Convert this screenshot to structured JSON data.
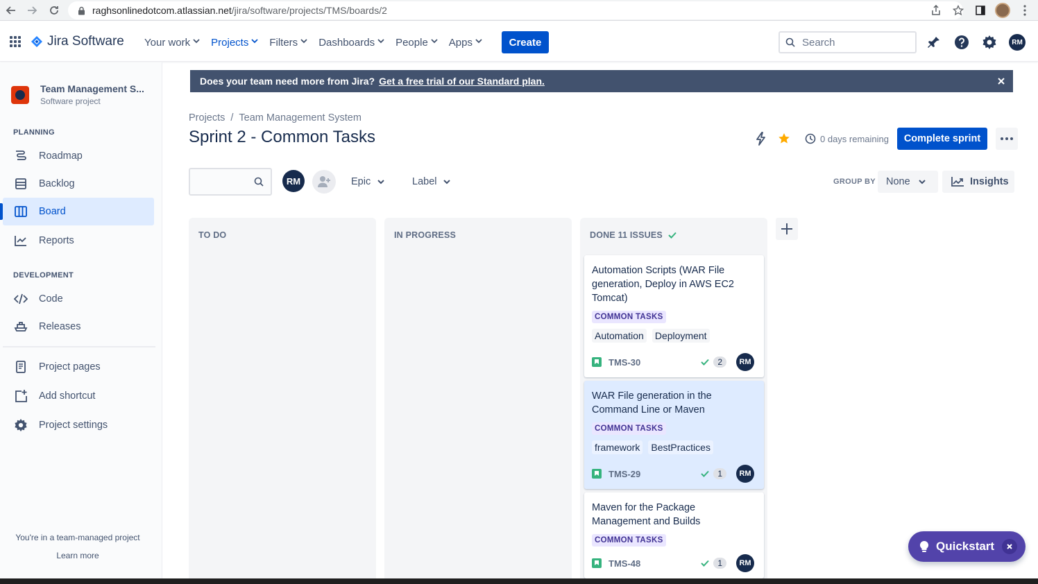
{
  "browser": {
    "url_host": "raghsonlinedotcom.atlassian.net",
    "url_path": "/jira/software/projects/TMS/boards/2"
  },
  "topnav": {
    "logo_text": "Jira Software",
    "items": [
      {
        "label": "Your work",
        "active": false
      },
      {
        "label": "Projects",
        "active": true
      },
      {
        "label": "Filters",
        "active": false
      },
      {
        "label": "Dashboards",
        "active": false
      },
      {
        "label": "People",
        "active": false
      },
      {
        "label": "Apps",
        "active": false
      }
    ],
    "create_label": "Create",
    "search_placeholder": "Search",
    "user_initials": "RM"
  },
  "sidebar": {
    "project_name": "Team Management S...",
    "project_type": "Software project",
    "planning_title": "PLANNING",
    "planning_items": [
      {
        "label": "Roadmap",
        "icon": "roadmap-icon"
      },
      {
        "label": "Backlog",
        "icon": "backlog-icon"
      },
      {
        "label": "Board",
        "icon": "board-icon",
        "active": true
      },
      {
        "label": "Reports",
        "icon": "reports-icon"
      }
    ],
    "development_title": "DEVELOPMENT",
    "development_items": [
      {
        "label": "Code",
        "icon": "code-icon"
      },
      {
        "label": "Releases",
        "icon": "releases-icon"
      }
    ],
    "other_items": [
      {
        "label": "Project pages",
        "icon": "project-pages-icon"
      },
      {
        "label": "Add shortcut",
        "icon": "add-shortcut-icon"
      },
      {
        "label": "Project settings",
        "icon": "gear-icon"
      }
    ],
    "footer_text": "You're in a team-managed project",
    "footer_link": "Learn more"
  },
  "banner": {
    "text": "Does your team need more from Jira?",
    "link": "Get a free trial of our Standard plan."
  },
  "breadcrumb": [
    "Projects",
    "/",
    "Team Management System"
  ],
  "page_title": "Sprint 2 - Common Tasks",
  "header": {
    "remaining": "0 days remaining",
    "complete_label": "Complete sprint"
  },
  "filters": {
    "avatar_initials": "RM",
    "epic_label": "Epic",
    "label_label": "Label",
    "group_by_title": "GROUP BY",
    "group_by_value": "None",
    "insights_label": "Insights"
  },
  "columns": [
    {
      "title": "TO DO"
    },
    {
      "title": "IN PROGRESS"
    },
    {
      "title": "DONE 11 ISSUES"
    }
  ],
  "cards": [
    {
      "title": "Automation Scripts (WAR File generation, Deploy in AWS EC2 Tomcat)",
      "epic": "COMMON TASKS",
      "labels": [
        "Automation",
        "Deployment"
      ],
      "key": "TMS-30",
      "count": "2",
      "assignee": "RM"
    },
    {
      "title": "WAR File generation in the Command Line or Maven",
      "epic": "COMMON TASKS",
      "labels": [
        "framework",
        "BestPractices"
      ],
      "key": "TMS-29",
      "count": "1",
      "assignee": "RM"
    },
    {
      "title": "Maven for the Package Management and Builds",
      "epic": "COMMON TASKS",
      "labels": [],
      "key": "TMS-48",
      "count": "1",
      "assignee": "RM"
    }
  ],
  "quickstart": {
    "label": "Quickstart"
  },
  "colors": {
    "primary": "#0052CC",
    "banner": "#42526E",
    "epic_bg": "#EAE6FF",
    "epic_text": "#403294",
    "story_green": "#36B37E",
    "quickstart": "#5243AA",
    "star": "#FFAB00"
  }
}
